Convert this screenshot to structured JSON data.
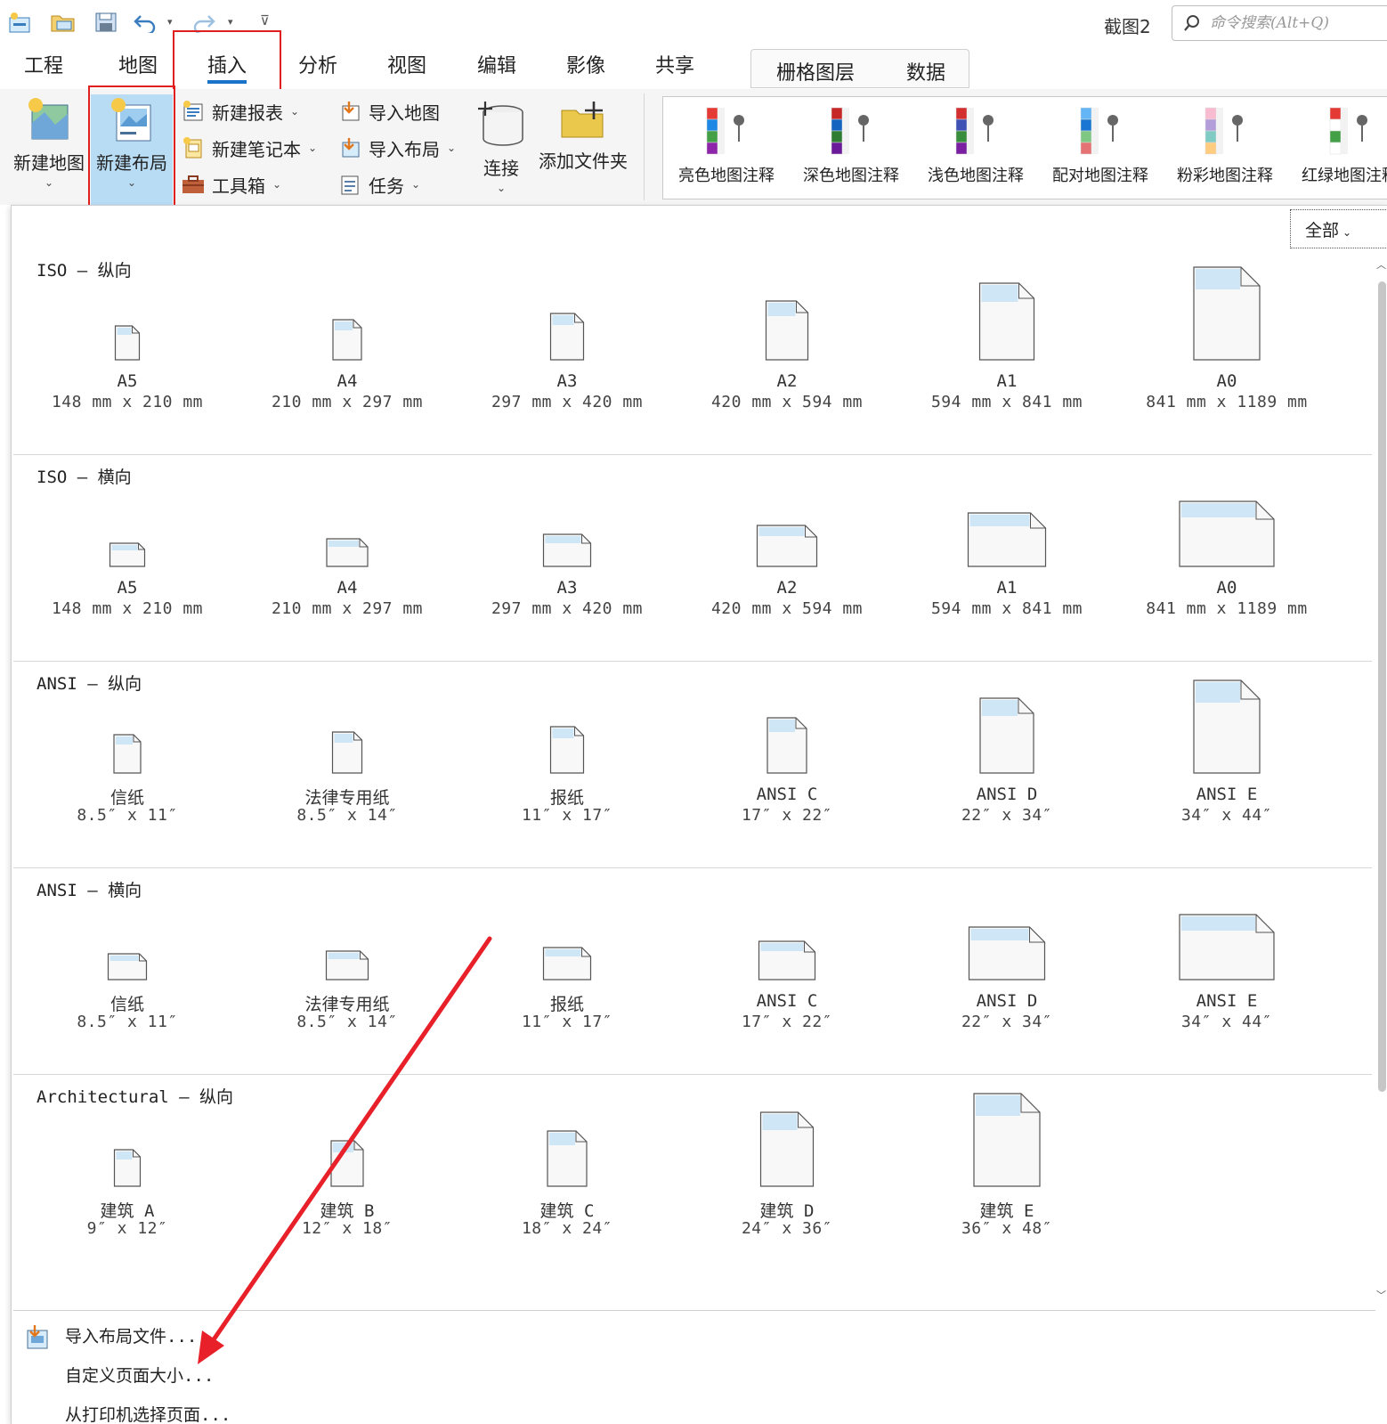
{
  "title_bar": {
    "doc_title": "截图2",
    "search_placeholder": "命令搜索(Alt+Q)"
  },
  "tabs": [
    {
      "label": "工程"
    },
    {
      "label": "地图"
    },
    {
      "label": "插入",
      "active": true
    },
    {
      "label": "分析"
    },
    {
      "label": "视图"
    },
    {
      "label": "编辑"
    },
    {
      "label": "影像"
    },
    {
      "label": "共享"
    }
  ],
  "context_tabs": [
    {
      "label": "栅格图层"
    },
    {
      "label": "数据"
    }
  ],
  "ribbon": {
    "new_map": "新建地图",
    "new_layout": "新建布局",
    "new_report": "新建报表",
    "new_notebook": "新建笔记本",
    "toolbox": "工具箱",
    "import_map": "导入地图",
    "import_layout": "导入布局",
    "task": "任务",
    "connect": "连接",
    "add_folder": "添加文件夹",
    "gallery": [
      {
        "label": "亮色地图注释",
        "colors": [
          "#e53935",
          "#1e88e5",
          "#43a047",
          "#8e24aa"
        ]
      },
      {
        "label": "深色地图注释",
        "colors": [
          "#c62828",
          "#1565c0",
          "#2e7d32",
          "#6a1b9a"
        ]
      },
      {
        "label": "浅色地图注释",
        "colors": [
          "#d32f2f",
          "#3f51b5",
          "#388e3c",
          "#7b1fa2"
        ]
      },
      {
        "label": "配对地图注释",
        "colors": [
          "#64b5f6",
          "#1976d2",
          "#81c784",
          "#e57373"
        ]
      },
      {
        "label": "粉彩地图注释",
        "colors": [
          "#f8bbd0",
          "#b39ddb",
          "#80cbc4",
          "#ffcc80"
        ]
      },
      {
        "label": "红绿地图注释",
        "colors": [
          "#e53935",
          "#ffffff",
          "#43a047",
          "#ffffff"
        ]
      }
    ]
  },
  "panel": {
    "filter": "全部",
    "sections": [
      {
        "header": "ISO – 纵向",
        "orientation": "portrait",
        "items": [
          {
            "name": "A5",
            "size": "148 mm x 210 mm",
            "scale": 0.22
          },
          {
            "name": "A4",
            "size": "210 mm x 297 mm",
            "scale": 0.3
          },
          {
            "name": "A3",
            "size": "297 mm x 420 mm",
            "scale": 0.38
          },
          {
            "name": "A2",
            "size": "420 mm x 594 mm",
            "scale": 0.55
          },
          {
            "name": "A1",
            "size": "594 mm x 841 mm",
            "scale": 0.78
          },
          {
            "name": "A0",
            "size": "841 mm x 1189 mm",
            "scale": 1.0
          }
        ]
      },
      {
        "header": "ISO – 横向",
        "orientation": "landscape",
        "items": [
          {
            "name": "A5",
            "size": "148 mm x 210 mm",
            "scale": 0.22
          },
          {
            "name": "A4",
            "size": "210 mm x 297 mm",
            "scale": 0.3
          },
          {
            "name": "A3",
            "size": "297 mm x 420 mm",
            "scale": 0.38
          },
          {
            "name": "A2",
            "size": "420 mm x 594 mm",
            "scale": 0.55
          },
          {
            "name": "A1",
            "size": "594 mm x 841 mm",
            "scale": 0.78
          },
          {
            "name": "A0",
            "size": "841 mm x 1189 mm",
            "scale": 1.0
          }
        ]
      },
      {
        "header": "ANSI – 纵向",
        "orientation": "portrait",
        "items": [
          {
            "name": "信纸",
            "size": "8.5″ x 11″",
            "scale": 0.27
          },
          {
            "name": "法律专用纸",
            "size": "8.5″ x 14″",
            "scale": 0.31
          },
          {
            "name": "报纸",
            "size": "11″ x 17″",
            "scale": 0.38
          },
          {
            "name": "ANSI C",
            "size": "17″ x 22″",
            "scale": 0.5
          },
          {
            "name": "ANSI D",
            "size": "22″ x 34″",
            "scale": 0.76
          },
          {
            "name": "ANSI E",
            "size": "34″ x 44″",
            "scale": 1.0
          }
        ]
      },
      {
        "header": "ANSI – 横向",
        "orientation": "landscape",
        "items": [
          {
            "name": "信纸",
            "size": "8.5″ x 11″",
            "scale": 0.27
          },
          {
            "name": "法律专用纸",
            "size": "8.5″ x 14″",
            "scale": 0.31
          },
          {
            "name": "报纸",
            "size": "11″ x 17″",
            "scale": 0.38
          },
          {
            "name": "ANSI C",
            "size": "17″ x 22″",
            "scale": 0.5
          },
          {
            "name": "ANSI D",
            "size": "22″ x 34″",
            "scale": 0.76
          },
          {
            "name": "ANSI E",
            "size": "34″ x 44″",
            "scale": 1.0
          }
        ]
      },
      {
        "header": "Architectural – 纵向",
        "orientation": "portrait",
        "items": [
          {
            "name": "建筑 A",
            "size": "9″ x 12″",
            "scale": 0.25
          },
          {
            "name": "建筑 B",
            "size": "12″ x 18″",
            "scale": 0.37
          },
          {
            "name": "建筑 C",
            "size": "18″ x 24″",
            "scale": 0.5
          },
          {
            "name": "建筑 D",
            "size": "24″ x 36″",
            "scale": 0.75
          },
          {
            "name": "建筑 E",
            "size": "36″ x 48″",
            "scale": 1.0
          }
        ]
      }
    ],
    "footer": {
      "import_layout_file": "导入布局文件...",
      "custom_page_size": "自定义页面大小...",
      "from_printer": "从打印机选择页面..."
    }
  },
  "annotation": {
    "arrow_color": "#e8202a",
    "highlight_color": "#e02020"
  }
}
